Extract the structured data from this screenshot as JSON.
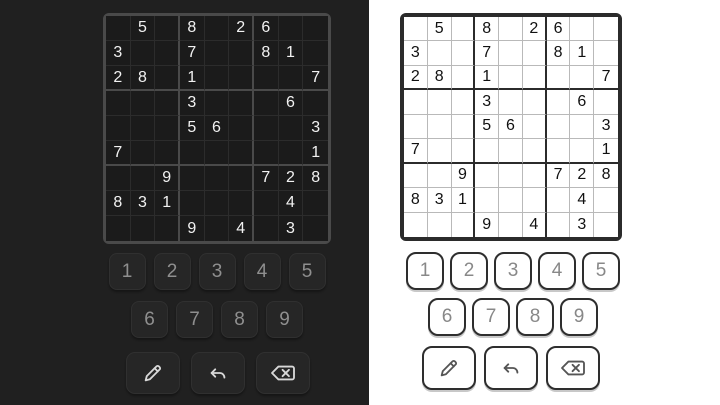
{
  "grid": [
    [
      "",
      "5",
      "",
      "8",
      "",
      "2",
      "6",
      "",
      ""
    ],
    [
      "3",
      "",
      "",
      "7",
      "",
      "",
      "8",
      "1",
      ""
    ],
    [
      "2",
      "8",
      "",
      "1",
      "",
      "",
      "",
      "",
      "7"
    ],
    [
      "",
      "",
      "",
      "3",
      "",
      "",
      "",
      "6",
      ""
    ],
    [
      "",
      "",
      "",
      "5",
      "6",
      "",
      "",
      "",
      "3"
    ],
    [
      "7",
      "",
      "",
      "",
      "",
      "",
      "",
      "",
      "1"
    ],
    [
      "",
      "",
      "9",
      "",
      "",
      "",
      "7",
      "2",
      "8"
    ],
    [
      "8",
      "3",
      "1",
      "",
      "",
      "",
      "",
      "4",
      ""
    ],
    [
      "",
      "",
      "",
      "9",
      "",
      "4",
      "",
      "3",
      ""
    ]
  ],
  "numpad": {
    "row1": [
      "1",
      "2",
      "3",
      "4",
      "5"
    ],
    "row2": [
      "6",
      "7",
      "8",
      "9"
    ]
  },
  "tools": [
    {
      "name": "pencil-button",
      "icon": "pencil-icon"
    },
    {
      "name": "undo-button",
      "icon": "undo-icon"
    },
    {
      "name": "erase-button",
      "icon": "backspace-icon"
    }
  ],
  "themes": {
    "dark": {
      "background": "#202020",
      "board": "#1b1b1b",
      "text": "#f2f2f2",
      "button": "#262626",
      "button_text": "#8f8f8f"
    },
    "light": {
      "background": "#ffffff",
      "board": "#ffffff",
      "text": "#111111",
      "button": "#ffffff",
      "button_text": "#888888"
    }
  }
}
